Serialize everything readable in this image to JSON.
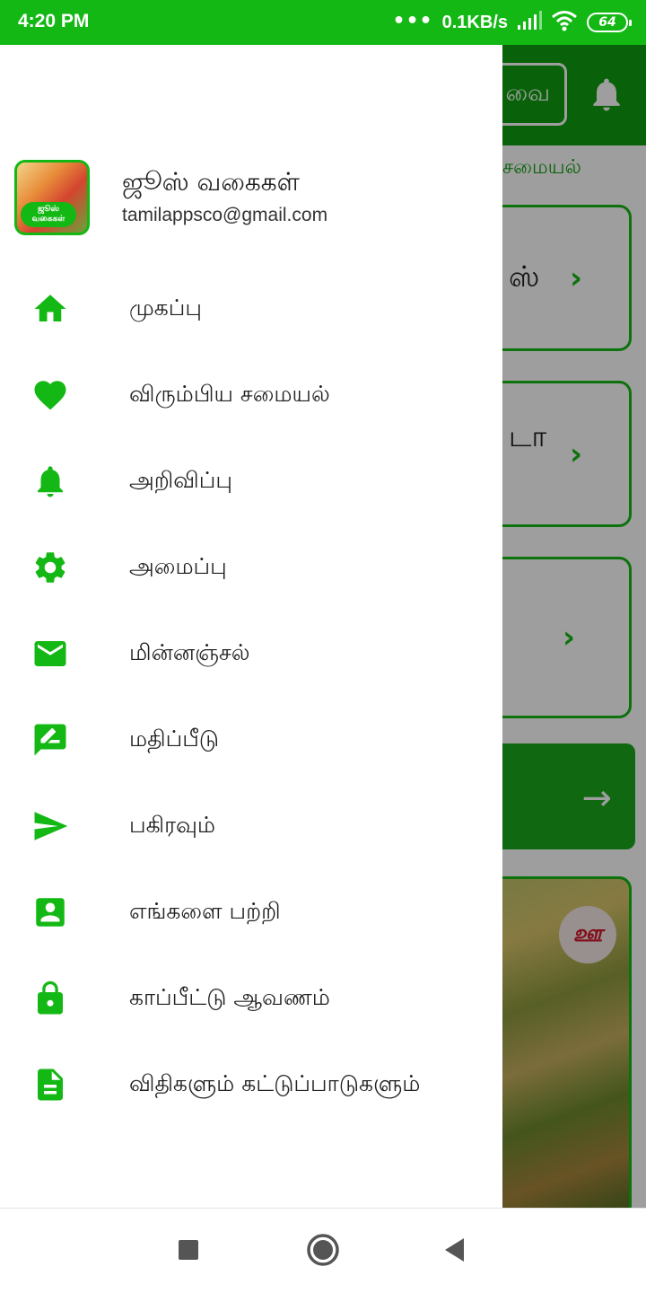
{
  "status_bar": {
    "time": "4:20 PM",
    "dots": "•••",
    "net_speed": "0.1KB/s",
    "battery": "64"
  },
  "background_app": {
    "search_pill_label": "வை",
    "subtitle": "சமையல்",
    "cards": [
      {
        "text": "ஸ்"
      },
      {
        "text": "டா"
      },
      {
        "text": ""
      }
    ],
    "photo_badge": "ஊ"
  },
  "drawer": {
    "app_name": "ஜூஸ் வகைகள்",
    "email": "tamilappsco@gmail.com",
    "logo_text": "ஜூஸ் வகைகள்",
    "items": [
      {
        "label": "முகப்பு",
        "icon": "home-icon"
      },
      {
        "label": "விரும்பிய சமையல்",
        "icon": "heart-icon"
      },
      {
        "label": "அறிவிப்பு",
        "icon": "bell-icon"
      },
      {
        "label": "அமைப்பு",
        "icon": "gear-icon"
      },
      {
        "label": "மின்னஞ்சல்",
        "icon": "mail-icon"
      },
      {
        "label": "மதிப்பீடு",
        "icon": "rate-review-icon"
      },
      {
        "label": "பகிரவும்",
        "icon": "send-icon"
      },
      {
        "label": "எங்களை பற்றி",
        "icon": "contact-card-icon"
      },
      {
        "label": "காப்பீட்டு ஆவணம்",
        "icon": "lock-icon"
      },
      {
        "label": "விதிகளும் கட்டுப்பாடுகளும்",
        "icon": "document-icon"
      }
    ]
  },
  "colors": {
    "accent": "#14b814",
    "toolbar": "#0f9f0f"
  }
}
